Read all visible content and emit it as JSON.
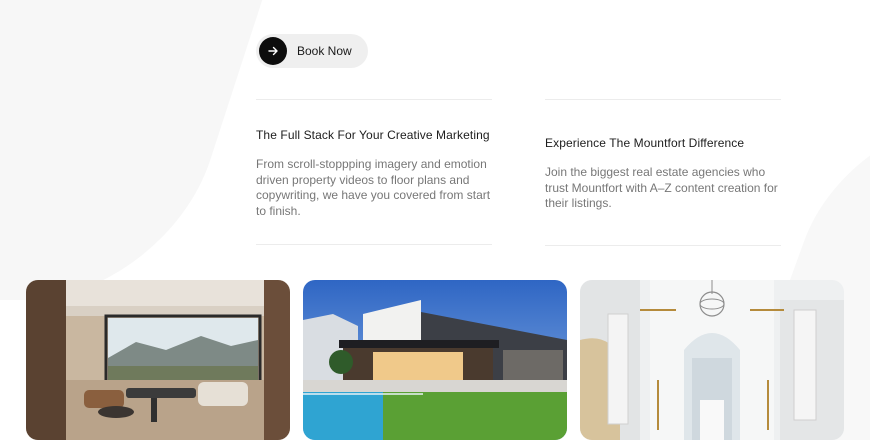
{
  "book_button": {
    "label": "Book Now",
    "icon": "arrow-right-icon"
  },
  "columns": [
    {
      "title": "The Full Stack For Your Creative Marketing",
      "body": "From scroll-stoppping imagery and emotion driven property videos to floor plans and copywriting, we have you covered from start to finish."
    },
    {
      "title": "Experience The Mountfort Difference",
      "body": "Join the biggest real estate agencies who trust Mountfort with A–Z content creation for their listings."
    }
  ],
  "gallery": [
    {
      "subject": "living-room-photo"
    },
    {
      "subject": "house-exterior-pool-photo"
    },
    {
      "subject": "white-hallway-chandelier-photo"
    }
  ],
  "colors": {
    "button_bg": "#efefef",
    "button_circle": "#0d0d0d",
    "heading": "#1d1d1d",
    "body_text": "#777777"
  }
}
